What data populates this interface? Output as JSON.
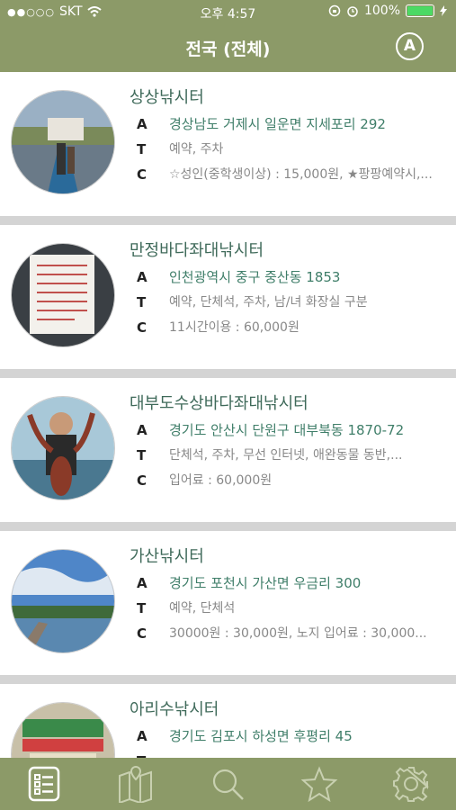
{
  "status": {
    "carrier": "SKT",
    "time": "오후 4:57",
    "battery": "100%"
  },
  "header": {
    "title": "전국 (전체)",
    "filter_label": "A"
  },
  "labels": {
    "a": "A",
    "t": "T",
    "c": "C"
  },
  "listings": [
    {
      "name": "상상낚시터",
      "address": "경상남도 거제시 일운면 지세포리 292",
      "tags": "예약, 주차",
      "cost": "☆성인(중학생이상) : 15,000원, ★팡팡예약시,..."
    },
    {
      "name": "만정바다좌대낚시터",
      "address": "인천광역시 중구 중산동 1853",
      "tags": "예약, 단체석, 주차, 남/녀 화장실 구분",
      "cost": "11시간이용 : 60,000원"
    },
    {
      "name": "대부도수상바다좌대낚시터",
      "address": "경기도 안산시 단원구 대부북동 1870-72",
      "tags": "단체석, 주차, 무선 인터넷, 애완동물 동반,...",
      "cost": "입어료 : 60,000원"
    },
    {
      "name": "가산낚시터",
      "address": "경기도 포천시 가산면 우금리 300",
      "tags": "예약, 단체석",
      "cost": "30000원 : 30,000원, 노지 입어료 : 30,000..."
    },
    {
      "name": "아리수낚시터",
      "address": "경기도 김포시 하성면 후평리 45",
      "tags": "",
      "cost": ""
    }
  ],
  "tabs": [
    "list-icon",
    "map-icon",
    "search-icon",
    "star-icon",
    "gear-icon"
  ],
  "colors": {
    "accent": "#8c9a68",
    "address": "#3f7e69",
    "name": "#3f6a5a"
  }
}
